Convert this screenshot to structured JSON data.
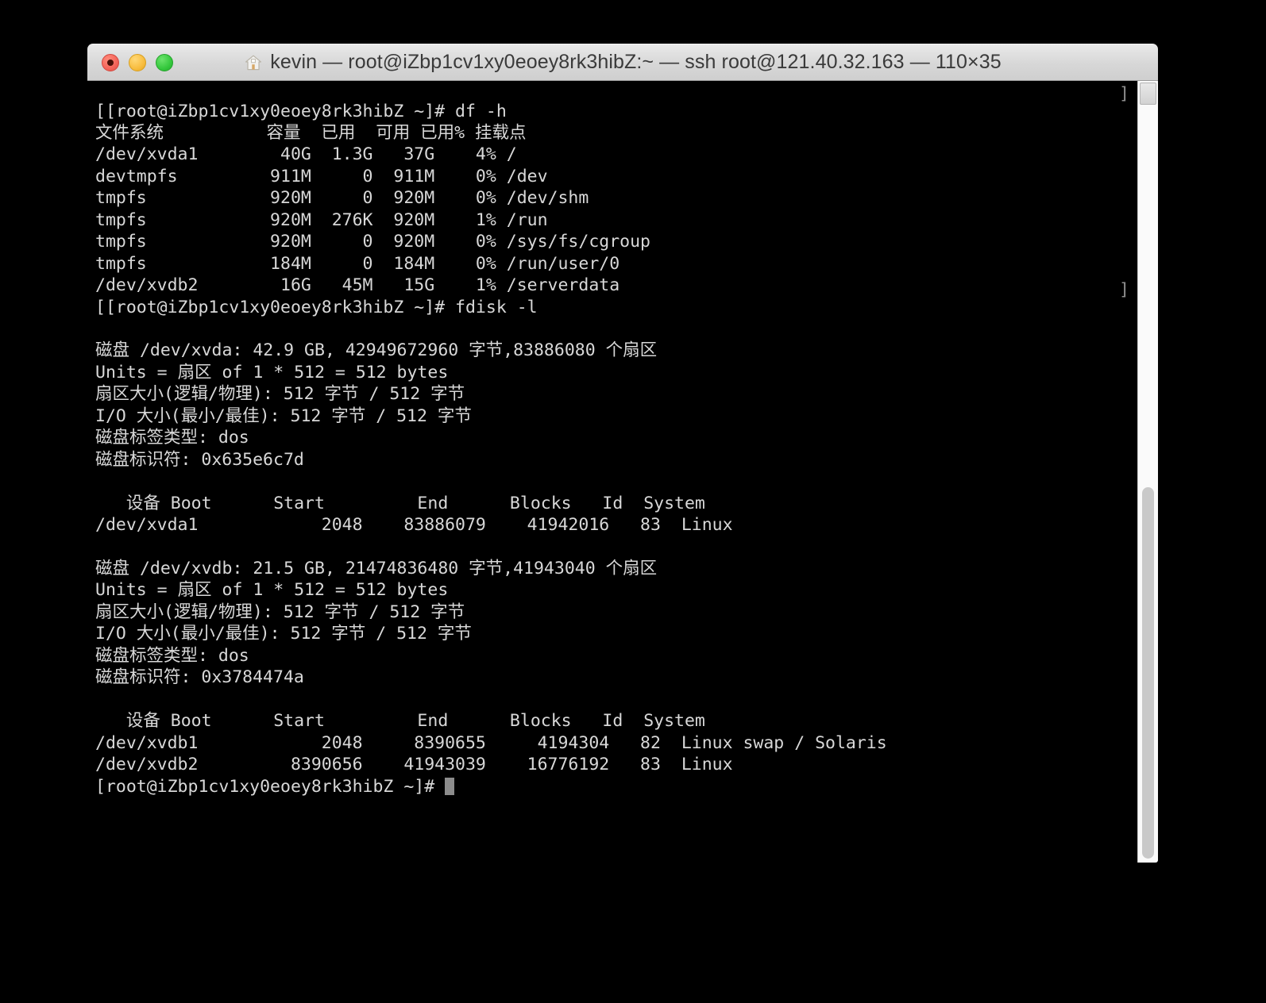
{
  "window": {
    "title": "kevin — root@iZbp1cv1xy0eoey8rk3hibZ:~ — ssh root@121.40.32.163 — 110×35",
    "home_icon": "home-icon",
    "controls": {
      "close_label": "close",
      "minimize_label": "minimize",
      "zoom_label": "zoom"
    },
    "columns": "110",
    "rows": "35"
  },
  "colors": {
    "background": "#000000",
    "foreground": "#d8d8d8",
    "dim_foreground": "#9a9a9a",
    "titlebar": "#d7d7d7",
    "title_text": "#3a3a3a",
    "close": "#f4645a",
    "minimize": "#f8bd3f",
    "zoom": "#35c83d",
    "cursor": "#8c8c8c",
    "scrollbar_track": "#fafafa",
    "scrollbar_thumb": "#c9c9c9"
  },
  "terminal": {
    "prompt": "[root@iZbp1cv1xy0eoey8rk3hibZ ~]#",
    "commands": [
      "df -h",
      "fdisk -l"
    ],
    "cursor_glyph": "block-cursor",
    "right_edge_markers": [
      "]",
      "]"
    ],
    "content": "[[root@iZbp1cv1xy0eoey8rk3hibZ ~]# df -h\n文件系统          容量  已用  可用 已用% 挂载点\n/dev/xvda1        40G  1.3G   37G    4% /\ndevtmpfs         911M     0  911M    0% /dev\ntmpfs            920M     0  920M    0% /dev/shm\ntmpfs            920M  276K  920M    1% /run\ntmpfs            920M     0  920M    0% /sys/fs/cgroup\ntmpfs            184M     0  184M    0% /run/user/0\n/dev/xvdb2        16G   45M   15G    1% /serverdata\n[[root@iZbp1cv1xy0eoey8rk3hibZ ~]# fdisk -l\n\n磁盘 /dev/xvda: 42.9 GB, 42949672960 字节,83886080 个扇区\nUnits = 扇区 of 1 * 512 = 512 bytes\n扇区大小(逻辑/物理): 512 字节 / 512 字节\nI/O 大小(最小/最佳): 512 字节 / 512 字节\n磁盘标签类型: dos\n磁盘标识符: 0x635e6c7d\n\n   设备 Boot      Start         End      Blocks   Id  System\n/dev/xvda1            2048    83886079    41942016   83  Linux\n\n磁盘 /dev/xvdb: 21.5 GB, 21474836480 字节,41943040 个扇区\nUnits = 扇区 of 1 * 512 = 512 bytes\n扇区大小(逻辑/物理): 512 字节 / 512 字节\nI/O 大小(最小/最佳): 512 字节 / 512 字节\n磁盘标签类型: dos\n磁盘标识符: 0x3784474a\n\n   设备 Boot      Start         End      Blocks   Id  System\n/dev/xvdb1            2048     8390655     4194304   82  Linux swap / Solaris\n/dev/xvdb2         8390656    41943039    16776192   83  Linux\n[root@iZbp1cv1xy0eoey8rk3hibZ ~]# ",
    "df_table": {
      "header": [
        "文件系统",
        "容量",
        "已用",
        "可用",
        "已用%",
        "挂载点"
      ],
      "rows": [
        [
          "/dev/xvda1",
          "40G",
          "1.3G",
          "37G",
          "4%",
          "/"
        ],
        [
          "devtmpfs",
          "911M",
          "0",
          "911M",
          "0%",
          "/dev"
        ],
        [
          "tmpfs",
          "920M",
          "0",
          "920M",
          "0%",
          "/dev/shm"
        ],
        [
          "tmpfs",
          "920M",
          "276K",
          "920M",
          "1%",
          "/run"
        ],
        [
          "tmpfs",
          "920M",
          "0",
          "920M",
          "0%",
          "/sys/fs/cgroup"
        ],
        [
          "tmpfs",
          "184M",
          "0",
          "184M",
          "0%",
          "/run/user/0"
        ],
        [
          "/dev/xvdb2",
          "16G",
          "45M",
          "15G",
          "1%",
          "/serverdata"
        ]
      ]
    },
    "disks": [
      {
        "name": "/dev/xvda",
        "size_human": "42.9 GB",
        "size_bytes": "42949672960",
        "sectors": "83886080",
        "units": "Units = 扇区 of 1 * 512 = 512 bytes",
        "sector_size": "扇区大小(逻辑/物理): 512 字节 / 512 字节",
        "io_size": "I/O 大小(最小/最佳): 512 字节 / 512 字节",
        "label_type": "磁盘标签类型: dos",
        "identifier": "磁盘标识符: 0x635e6c7d",
        "part_header": [
          "设备",
          "Boot",
          "Start",
          "End",
          "Blocks",
          "Id",
          "System"
        ],
        "partitions": [
          [
            "/dev/xvda1",
            "",
            "2048",
            "83886079",
            "41942016",
            "83",
            "Linux"
          ]
        ]
      },
      {
        "name": "/dev/xvdb",
        "size_human": "21.5 GB",
        "size_bytes": "21474836480",
        "sectors": "41943040",
        "units": "Units = 扇区 of 1 * 512 = 512 bytes",
        "sector_size": "扇区大小(逻辑/物理): 512 字节 / 512 字节",
        "io_size": "I/O 大小(最小/最佳): 512 字节 / 512 字节",
        "label_type": "磁盘标签类型: dos",
        "identifier": "磁盘标识符: 0x3784474a",
        "part_header": [
          "设备",
          "Boot",
          "Start",
          "End",
          "Blocks",
          "Id",
          "System"
        ],
        "partitions": [
          [
            "/dev/xvdb1",
            "",
            "2048",
            "8390655",
            "4194304",
            "82",
            "Linux swap / Solaris"
          ],
          [
            "/dev/xvdb2",
            "",
            "8390656",
            "41943039",
            "16776192",
            "83",
            "Linux"
          ]
        ]
      }
    ]
  }
}
